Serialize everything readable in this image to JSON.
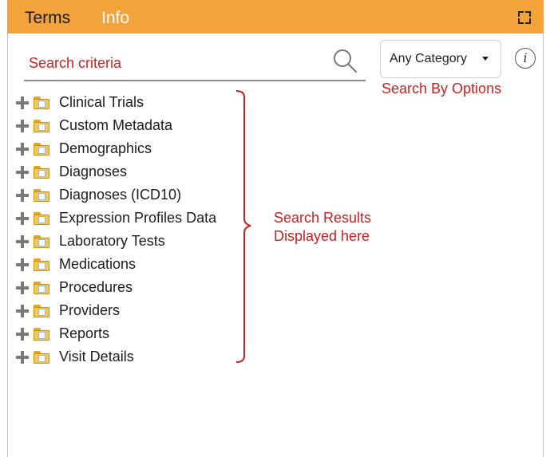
{
  "header": {
    "tabs": [
      {
        "label": "Terms",
        "active": true
      },
      {
        "label": "Info",
        "active": false
      }
    ],
    "accent_color": "#F2A33A",
    "expand_icon": "expand-icon"
  },
  "search": {
    "placeholder": "Search criteria",
    "value": "",
    "icon": "search-icon"
  },
  "category_select": {
    "selected": "Any Category",
    "icon": "caret-down-icon"
  },
  "info_button": {
    "glyph": "i",
    "icon": "info-icon"
  },
  "annotations": {
    "search_by": "Search By Options",
    "results_line1": "Search Results",
    "results_line2": "Displayed here",
    "color": "#CC1F1F"
  },
  "tree": {
    "items": [
      {
        "label": "Clinical Trials"
      },
      {
        "label": "Custom Metadata"
      },
      {
        "label": "Demographics"
      },
      {
        "label": "Diagnoses"
      },
      {
        "label": "Diagnoses (ICD10)"
      },
      {
        "label": "Expression Profiles Data"
      },
      {
        "label": "Laboratory Tests"
      },
      {
        "label": "Medications"
      },
      {
        "label": "Procedures"
      },
      {
        "label": "Providers"
      },
      {
        "label": "Reports"
      },
      {
        "label": "Visit Details"
      }
    ]
  }
}
